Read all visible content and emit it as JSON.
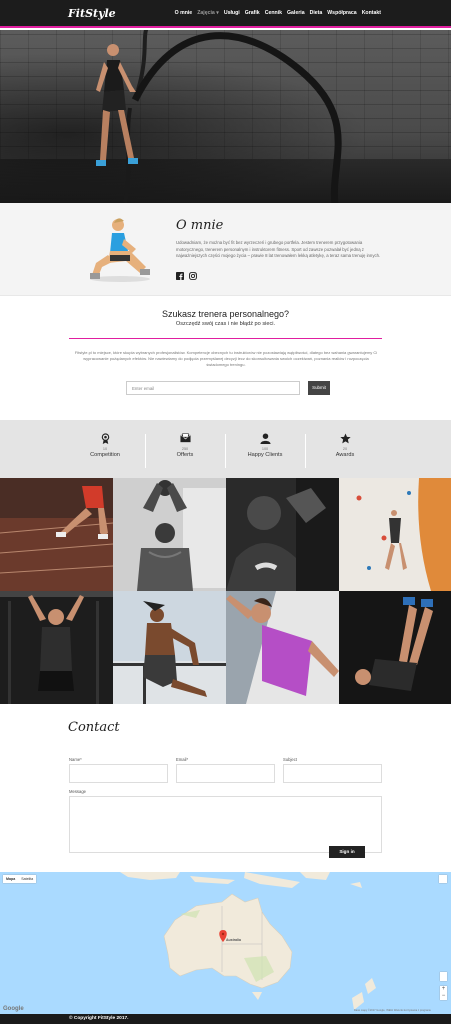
{
  "brand": "FitStyle",
  "nav": {
    "items": [
      "O mnie",
      "Zajęcia ▾",
      "Usługi",
      "Grafik",
      "Cennik",
      "Galeria",
      "Dieta",
      "Współpraca",
      "Kontakt"
    ]
  },
  "about": {
    "title": "O mnie",
    "text": "Udowadniam, że można być fit bez wyrzeczeń i grubego portfela. Jestem trenerem przygotowania motorycznego, trenerem personalnym i instruktorem fitness. Sport od zawsze pozwalał być jedną z najważniejszych części mojego życia – prawie 8 lat trenowałem lekką atletykę, a teraz sama trenuję innych.",
    "social": [
      "facebook-icon",
      "instagram-icon"
    ]
  },
  "trainer": {
    "title": "Szukasz trenera personalnego?",
    "subtitle": "Oszczędź swój czas i nie błądź po sieci.",
    "text": "Fitstyle.pl to miejsce, które skupia wybranych profesjonalistów. Kompetencje obecnych tu instruktorów nie pozostawiają wątpliwości, dlatego bez wahania gwarantujemy Ci wypracowanie pożądanych efektów. Nie nawiewiamy do podjęcia przemyślanej decyzji lecz do skonsultowania swoich oczekiwań, poznania realiów i rozpoczęcia świadomego treningu.",
    "email_placeholder": "Enter email",
    "submit_label": "Submit"
  },
  "stats": [
    {
      "icon": "medal-icon",
      "value": "10",
      "label": "Competition"
    },
    {
      "icon": "mail-icon",
      "value": "250",
      "label": "Offerts"
    },
    {
      "icon": "user-icon",
      "value": "100",
      "label": "Happy Clients"
    },
    {
      "icon": "star-icon",
      "value": "20",
      "label": "Awards"
    }
  ],
  "contact": {
    "title": "Contact",
    "name_label": "Name*",
    "email_label": "Email*",
    "subject_label": "Subject",
    "message_label": "Message",
    "signin_label": "Sign in"
  },
  "map": {
    "type_map": "Mapa",
    "type_satellite": "Satelita",
    "region_label": "Australia",
    "google_label": "Google",
    "credit": "Dane mapy ©2017 Google, INEGI  Warunki korzystania z programu"
  },
  "footer": {
    "copyright": "© Copyright FitStyle 2017."
  },
  "colors": {
    "accent": "#e01ea0",
    "navbar": "#1c1c1c",
    "stats_bg": "#e4e4e4",
    "about_bg": "#f4f4f4",
    "map_water": "#aadaff",
    "land": "#f1eadb"
  }
}
